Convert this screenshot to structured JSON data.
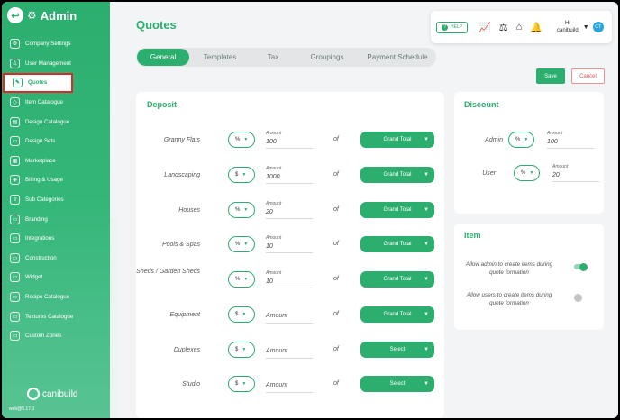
{
  "app": {
    "title": "Admin",
    "version": "web@5.17.0",
    "logo_text": "canibuild"
  },
  "sidebar": {
    "items": [
      {
        "label": "Company Settings",
        "icon": "gear-icon"
      },
      {
        "label": "User Management",
        "icon": "user-icon"
      },
      {
        "label": "Quotes",
        "icon": "quote-icon",
        "active": true
      },
      {
        "label": "Item Catalogue",
        "icon": "tag-icon"
      },
      {
        "label": "Design Catalogue",
        "icon": "layers-icon"
      },
      {
        "label": "Design Sets",
        "icon": "folder-icon"
      },
      {
        "label": "Marketplace",
        "icon": "store-icon"
      },
      {
        "label": "Billing & Usage",
        "icon": "shield-icon"
      },
      {
        "label": "Sub Categories",
        "icon": "list-icon"
      },
      {
        "label": "Branding",
        "icon": "folder-icon"
      },
      {
        "label": "Integrations",
        "icon": "folder-icon"
      },
      {
        "label": "Construction",
        "icon": "folder-icon"
      },
      {
        "label": "Widget",
        "icon": "folder-icon"
      },
      {
        "label": "Recipe Catalogue",
        "icon": "folder-icon"
      },
      {
        "label": "Textures Catalogue",
        "icon": "folder-icon"
      },
      {
        "label": "Custom Zones",
        "icon": "folder-icon"
      }
    ]
  },
  "header": {
    "title": "Quotes",
    "help_label": "HELP",
    "greeting": "Hi",
    "username": "canibuild",
    "avatar_initials": "CT"
  },
  "tabs": [
    {
      "label": "General",
      "active": true
    },
    {
      "label": "Templates"
    },
    {
      "label": "Tax"
    },
    {
      "label": "Groupings"
    },
    {
      "label": "Payment Schedule"
    }
  ],
  "actions": {
    "save": "Save",
    "cancel": "Cancel"
  },
  "deposit": {
    "title": "Deposit",
    "amount_label": "Amount",
    "amount_placeholder": "Amount",
    "of_label": "of",
    "rows": [
      {
        "label": "Granny Flats",
        "unit": "%",
        "amount": "100",
        "basis": "Grand Total"
      },
      {
        "label": "Landscaping",
        "unit": "$",
        "amount": "1000",
        "basis": "Grand Total"
      },
      {
        "label": "Houses",
        "unit": "%",
        "amount": "20",
        "basis": "Grand Total"
      },
      {
        "label": "Pools & Spas",
        "unit": "%",
        "amount": "10",
        "basis": "Grand Total"
      },
      {
        "label": "Sheds / Garden Sheds",
        "unit": "%",
        "amount": "10",
        "basis": "Grand Total"
      },
      {
        "label": "Equipment",
        "unit": "$",
        "amount": "",
        "basis": "Grand Total"
      },
      {
        "label": "Duplexes",
        "unit": "$",
        "amount": "",
        "basis": "Select"
      },
      {
        "label": "Studio",
        "unit": "$",
        "amount": "",
        "basis": "Select"
      }
    ]
  },
  "discount": {
    "title": "Discount",
    "amount_label": "Amount",
    "rows": [
      {
        "label": "Admin",
        "unit": "%",
        "amount": "100"
      },
      {
        "label": "User",
        "unit": "%",
        "amount": "20"
      }
    ]
  },
  "item": {
    "title": "Item",
    "toggles": [
      {
        "label": "Allow admin to create items during quote formation",
        "on": true
      },
      {
        "label": "Allow users to create items during quote formation",
        "on": false
      }
    ]
  },
  "colors": {
    "accent": "#2cae6f",
    "cancel": "#e05252",
    "avatar": "#2aa6d8"
  }
}
